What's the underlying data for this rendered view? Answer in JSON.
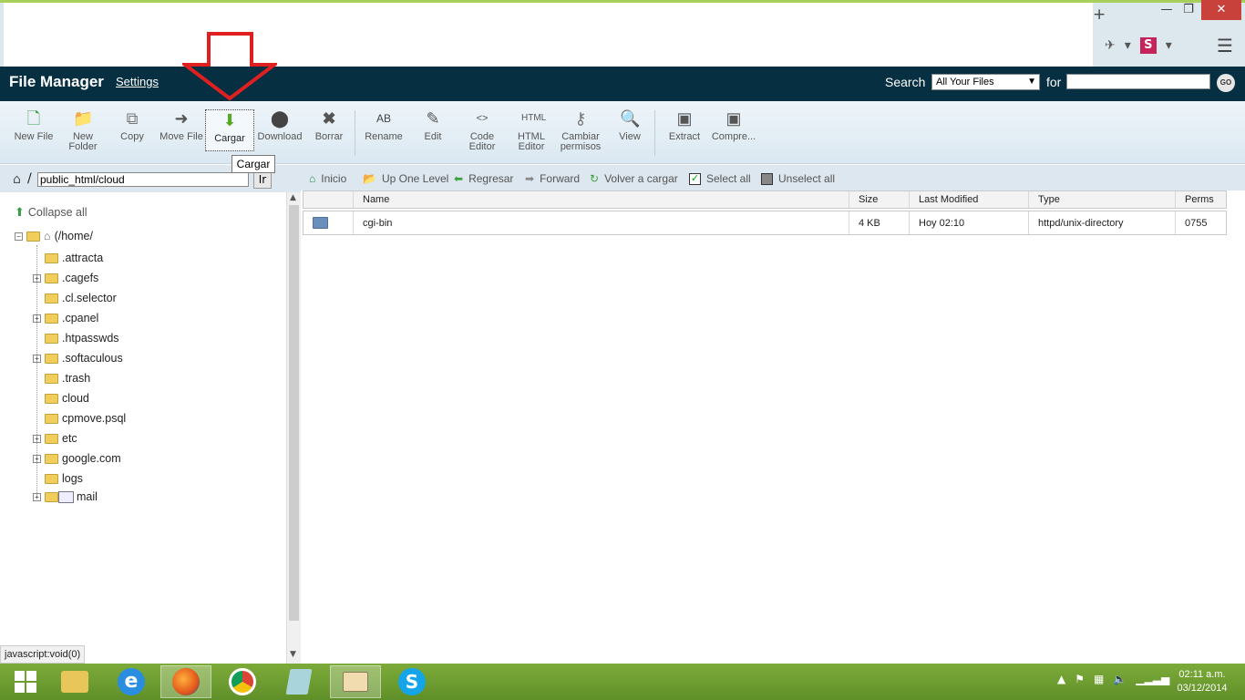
{
  "window": {
    "min_glyph": "—",
    "max_glyph": "❐",
    "close_glyph": "✕",
    "newtab_glyph": "+"
  },
  "header": {
    "title": "File Manager",
    "settings_label": "Settings",
    "search_label": "Search",
    "scope_value": "All Your Files",
    "for_label": "for",
    "go_label": "GO"
  },
  "toolbar": {
    "items": [
      {
        "label": "New File",
        "icon": "new-file-icon"
      },
      {
        "label": "New Folder",
        "icon": "new-folder-icon"
      },
      {
        "label": "Copy",
        "icon": "copy-icon"
      },
      {
        "label": "Move File",
        "icon": "move-file-icon"
      },
      {
        "label": "Cargar",
        "icon": "upload-icon"
      },
      {
        "label": "Download",
        "icon": "download-icon"
      },
      {
        "label": "Borrar",
        "icon": "delete-icon"
      },
      {
        "label": "Rename",
        "icon": "rename-icon"
      },
      {
        "label": "Edit",
        "icon": "edit-icon"
      },
      {
        "label": "Code Editor",
        "icon": "code-editor-icon"
      },
      {
        "label": "HTML Editor",
        "icon": "html-editor-icon"
      },
      {
        "label": "Cambiar permisos",
        "icon": "permissions-icon"
      },
      {
        "label": "View",
        "icon": "view-icon"
      },
      {
        "label": "Extract",
        "icon": "extract-icon"
      },
      {
        "label": "Compre...",
        "icon": "compress-icon"
      }
    ],
    "tooltip": "Cargar"
  },
  "path": {
    "value": "public_html/cloud",
    "go_label": "Ir",
    "slash": "/"
  },
  "nav": {
    "home": "Inicio",
    "up": "Up One Level",
    "back": "Regresar",
    "forward": "Forward",
    "reload": "Volver a cargar",
    "select_all": "Select all",
    "unselect_all": "Unselect all"
  },
  "tree": {
    "collapse_all": "Collapse all",
    "root": "(/home/",
    "items": [
      {
        "name": ".attracta",
        "expandable": false
      },
      {
        "name": ".cagefs",
        "expandable": true
      },
      {
        "name": ".cl.selector",
        "expandable": false
      },
      {
        "name": ".cpanel",
        "expandable": true
      },
      {
        "name": ".htpasswds",
        "expandable": false
      },
      {
        "name": ".softaculous",
        "expandable": true
      },
      {
        "name": ".trash",
        "expandable": false
      },
      {
        "name": "cloud",
        "expandable": false
      },
      {
        "name": "cpmove.psql",
        "expandable": false
      },
      {
        "name": "etc",
        "expandable": true
      },
      {
        "name": "google.com",
        "expandable": true
      },
      {
        "name": "logs",
        "expandable": false
      },
      {
        "name": "mail",
        "expandable": true
      }
    ]
  },
  "status_text": "javascript:void(0)",
  "table": {
    "headers": [
      "Name",
      "Size",
      "Last Modified",
      "Type",
      "Perms"
    ],
    "rows": [
      {
        "name": "cgi-bin",
        "size": "4 KB",
        "modified": "Hoy 02:10",
        "type": "httpd/unix-directory",
        "perms": "0755"
      }
    ]
  },
  "taskbar": {
    "apps": [
      "file-explorer-icon",
      "internet-explorer-icon",
      "firefox-icon",
      "chrome-icon",
      "notepad-icon",
      "remote-desktop-icon",
      "skype-icon"
    ],
    "time": "02:11 a.m.",
    "date": "03/12/2014"
  },
  "colors": {
    "header_bg": "#062f41",
    "taskbar_bg": "#6d9e30",
    "close_btn": "#c9413b",
    "annotation_arrow": "#e02020"
  }
}
